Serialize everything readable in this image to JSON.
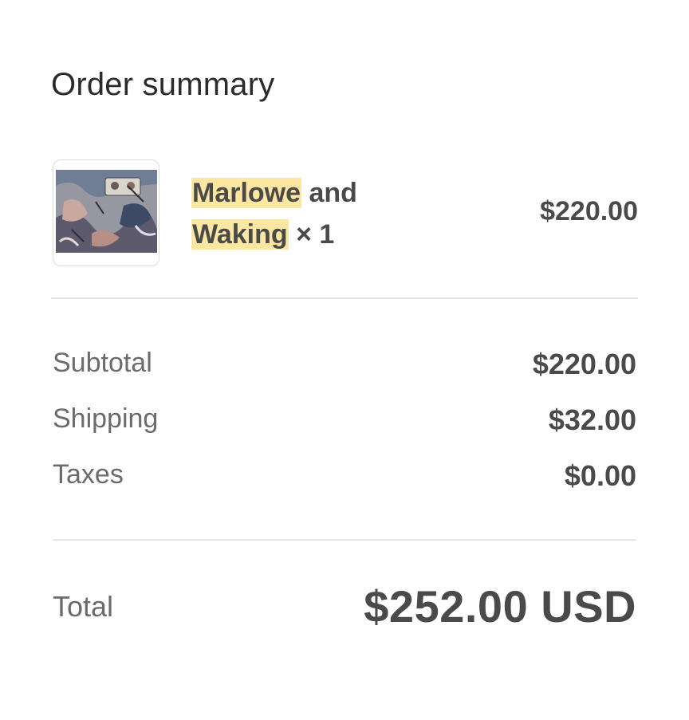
{
  "summary": {
    "title": "Order summary"
  },
  "item": {
    "image_icon": "product-artwork-thumbnail",
    "name_part1_highlighted": "Marlowe",
    "name_part1_rest": " and",
    "name_part2_highlighted": "Waking",
    "quantity_text": " × 1",
    "price": "$220.00",
    "highlight_color": "#fbe6a2"
  },
  "totals": {
    "subtotal_label": "Subtotal",
    "subtotal_value": "$220.00",
    "shipping_label": "Shipping",
    "shipping_value": "$32.00",
    "taxes_label": "Taxes",
    "taxes_value": "$0.00",
    "total_label": "Total",
    "total_value": "$252.00 USD"
  }
}
